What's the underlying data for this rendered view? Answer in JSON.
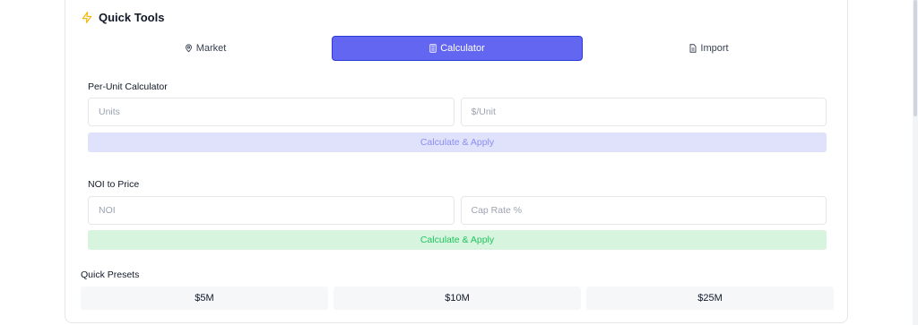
{
  "header": {
    "title": "Quick Tools",
    "icon": "lightning-icon",
    "accent": "#f5b301"
  },
  "tabs": [
    {
      "label": "Market",
      "icon": "map-pin-icon",
      "active": false
    },
    {
      "label": "Calculator",
      "icon": "calculator-icon",
      "active": true
    },
    {
      "label": "Import",
      "icon": "file-icon",
      "active": false
    }
  ],
  "per_unit": {
    "title": "Per-Unit Calculator",
    "units_placeholder": "Units",
    "price_placeholder": "$/Unit",
    "button_label": "Calculate & Apply"
  },
  "noi": {
    "title": "NOI to Price",
    "noi_placeholder": "NOI",
    "cap_placeholder": "Cap Rate %",
    "button_label": "Calculate & Apply"
  },
  "presets": {
    "title": "Quick Presets",
    "items": [
      "$5M",
      "$10M",
      "$25M"
    ]
  },
  "colors": {
    "active_tab": "#6366f1",
    "purple_button_bg": "#e0e1fb",
    "green_button_bg": "#d6f4de",
    "green_text": "#22c55e"
  }
}
